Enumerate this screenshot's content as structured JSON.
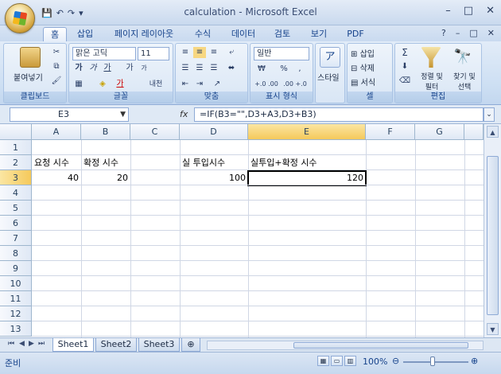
{
  "window": {
    "title": "calculation - Microsoft Excel",
    "controls": [
      "–",
      "□",
      "✕"
    ]
  },
  "qat": [
    "💾",
    "↶",
    "↷",
    "▾"
  ],
  "ribbon_tabs": [
    "홈",
    "삽입",
    "페이지 레이아웃",
    "수식",
    "데이터",
    "검토",
    "보기",
    "PDF"
  ],
  "active_tab": "홈",
  "help_controls": [
    "?",
    "–",
    "□",
    "✕"
  ],
  "ribbon": {
    "clipboard": {
      "label": "클립보드",
      "paste": "붙여넣기"
    },
    "font": {
      "label": "글꼴",
      "font_name": "맑은 고딕",
      "font_size": "11",
      "bold": "가",
      "italic": "가",
      "underline": "가",
      "grow": "가",
      "shrink": "가",
      "color_a": "가",
      "ww": "내천"
    },
    "alignment": {
      "label": "맞춤"
    },
    "number": {
      "label": "표시 형식",
      "format": "일반",
      "currency": "₩",
      "percent": "%",
      "comma": ",",
      "inc": "+.0 .00",
      "dec": ".00 +.0"
    },
    "styles": {
      "label": "스타일"
    },
    "cells": {
      "label": "셀",
      "insert": "삽입",
      "delete": "삭제",
      "format": "서식"
    },
    "editing": {
      "label": "편집",
      "sum": "Σ",
      "sort": "정렬 및 필터",
      "find": "찾기 및 선택"
    }
  },
  "formula_bar": {
    "name_box": "E3",
    "fx": "fx",
    "formula": "=IF(B3=\"\",D3+A3,D3+B3)"
  },
  "grid": {
    "columns": [
      "A",
      "B",
      "C",
      "D",
      "E",
      "F",
      "G"
    ],
    "rows": [
      "1",
      "2",
      "3",
      "4",
      "5",
      "6",
      "7",
      "8",
      "9",
      "10",
      "11",
      "12",
      "13"
    ],
    "cells": {
      "A2": "요청 시수",
      "B2": "확정 시수",
      "D2": "실 투입시수",
      "E2": "실투입+확정 시수",
      "A3": "40",
      "B3": "20",
      "D3": "100",
      "E3": "120"
    },
    "selected_cell": "E3"
  },
  "sheets": [
    "Sheet1",
    "Sheet2",
    "Sheet3"
  ],
  "active_sheet": "Sheet1",
  "sheet_nav": [
    "⏮",
    "◀",
    "▶",
    "⏭"
  ],
  "status": {
    "ready": "준비",
    "zoom": "100%",
    "zoom_minus": "⊖",
    "zoom_plus": "⊕"
  }
}
